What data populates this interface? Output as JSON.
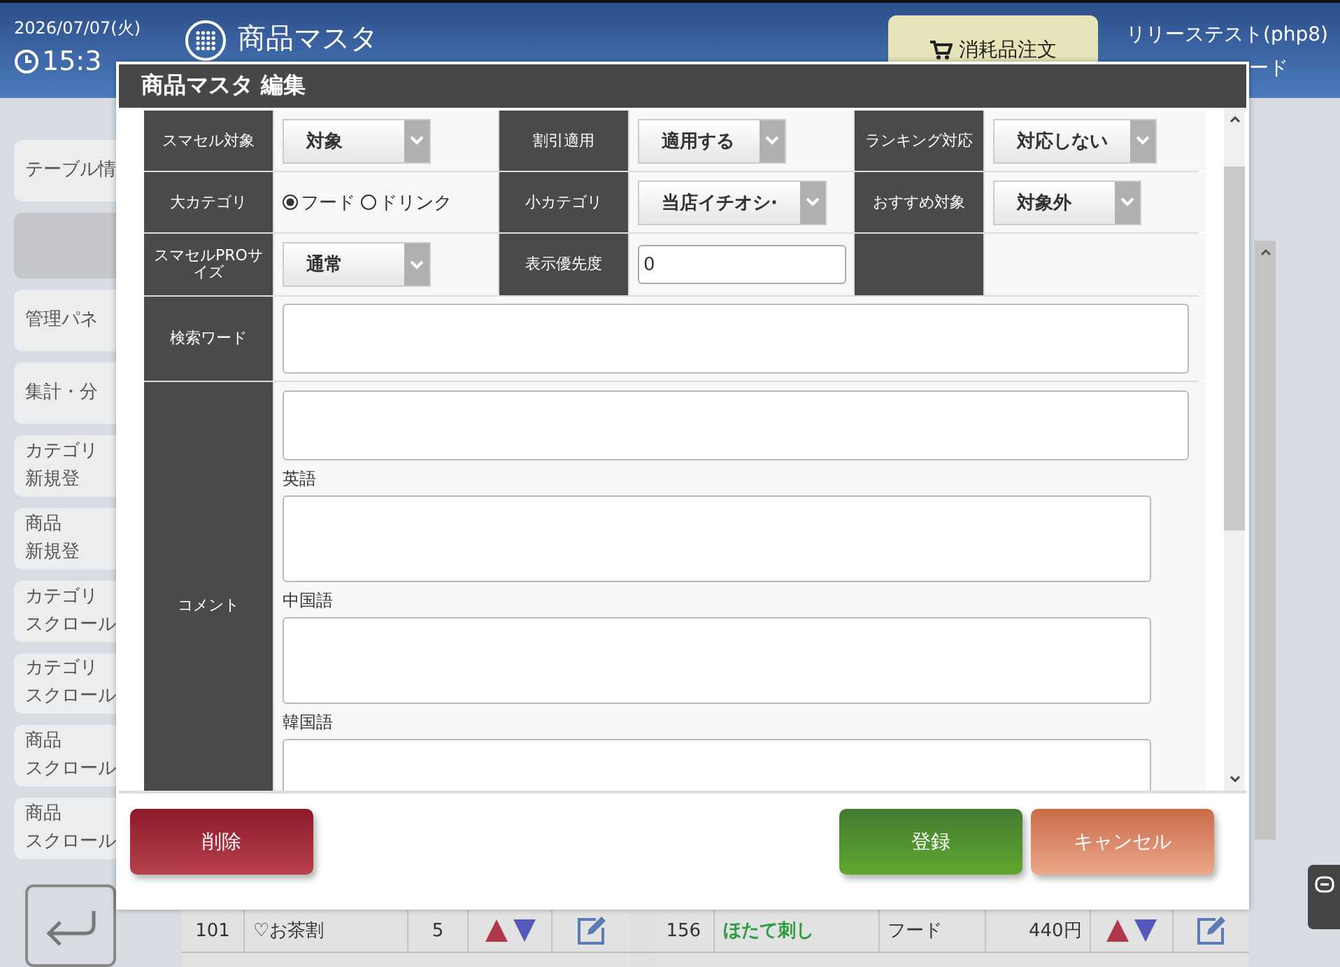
{
  "header": {
    "date": "2026/07/07(火)",
    "time": "15:3",
    "title": "商品マスタ",
    "order_button": "消耗品注文",
    "account": "リリーステスト(php8)",
    "mode": "ード"
  },
  "sidebar": {
    "items": [
      {
        "lines": [
          "テーブル情"
        ],
        "selected": false
      },
      {
        "selected": true
      },
      {
        "lines": [
          "管理パネ"
        ],
        "selected": false
      },
      {
        "lines": [
          "集計・分"
        ],
        "selected": false
      },
      {
        "lines": [
          "カテゴリ",
          "新規登"
        ],
        "selected": false
      },
      {
        "lines": [
          "商品",
          "新規登"
        ],
        "selected": false
      },
      {
        "lines": [
          "カテゴリ",
          "スクロール"
        ],
        "selected": false
      },
      {
        "lines": [
          "カテゴリ",
          "スクロール"
        ],
        "selected": false
      },
      {
        "lines": [
          "商品",
          "スクロール"
        ],
        "selected": false
      },
      {
        "lines": [
          "商品",
          "スクロール"
        ],
        "selected": false
      }
    ]
  },
  "background_table": {
    "rows": [
      {
        "left": {
          "id": "101",
          "name": "♡お茶割",
          "qty": "5"
        },
        "right": {
          "id": "156",
          "name": "ほたて刺し",
          "kind": "フード",
          "price": "440円"
        }
      }
    ]
  },
  "dialog": {
    "title": "商品マスタ 編集",
    "rows": [
      [
        {
          "kind": "select",
          "label": "スマセル対象",
          "value": "対象"
        },
        {
          "kind": "select",
          "label": "割引適用",
          "value": "適用する"
        },
        {
          "kind": "select",
          "label": "ランキング対応",
          "value": "対応しない"
        }
      ],
      [
        {
          "kind": "radio",
          "label": "大カテゴリ",
          "options": [
            {
              "label": "フード",
              "selected": true
            },
            {
              "label": "ドリンク",
              "selected": false
            }
          ]
        },
        {
          "kind": "select",
          "label": "小カテゴリ",
          "value": "当店イチオシ·"
        },
        {
          "kind": "select",
          "label": "おすすめ対象",
          "value": "対象外"
        }
      ],
      [
        {
          "kind": "select",
          "label": "スマセルPROサイズ",
          "value": "通常"
        },
        {
          "kind": "input",
          "label": "表示優先度",
          "value": "0"
        },
        {
          "kind": "blank"
        }
      ]
    ],
    "search": {
      "label": "検索ワード"
    },
    "comment": {
      "label": "コメント",
      "fields": [
        {
          "kind": "main"
        },
        {
          "kind": "translation",
          "label": "英語"
        },
        {
          "kind": "translation",
          "label": "中国語"
        },
        {
          "kind": "translation",
          "label": "韓国語"
        }
      ]
    },
    "buttons": [
      {
        "label": "削除",
        "kind": "danger"
      },
      {
        "label": "登録",
        "kind": "primary"
      },
      {
        "label": "キャンセル",
        "kind": "cancel"
      }
    ]
  }
}
